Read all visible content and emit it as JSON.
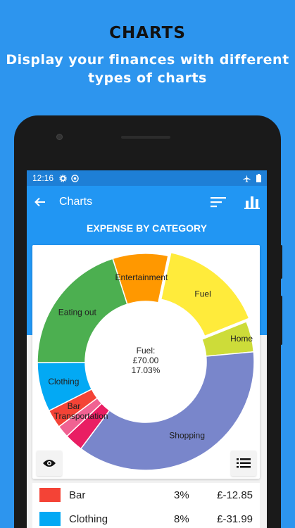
{
  "promo": {
    "title": "CHARTS",
    "subtitle_line1": "Display your finances with different",
    "subtitle_line2": "types of charts"
  },
  "status": {
    "time": "12:16"
  },
  "appbar": {
    "title": "Charts",
    "back_icon": "arrow-left-icon",
    "sort_icon": "sort-icon",
    "chart_type_icon": "bar-chart-icon"
  },
  "section_title": "EXPENSE BY CATEGORY",
  "chart_data": {
    "type": "pie",
    "title": "EXPENSE BY CATEGORY",
    "center": {
      "label": "Fuel:",
      "value": "£70.00",
      "percent": "17.03%"
    },
    "slices": [
      {
        "label": "Entertainment",
        "percent": 9,
        "color": "#FF9800",
        "pulled": false
      },
      {
        "label": "Fuel",
        "percent": 17.03,
        "color": "#FFEB3B",
        "pulled": true
      },
      {
        "label": "Home",
        "percent": 5,
        "color": "#CDDC39",
        "pulled": false
      },
      {
        "label": "Shopping",
        "percent": 40,
        "color": "#7986CB",
        "pulled": false
      },
      {
        "label": "",
        "percent": 3,
        "color": "#E91E63",
        "pulled": false
      },
      {
        "label": "Transportation",
        "percent": 2,
        "color": "#F06292",
        "pulled": false
      },
      {
        "label": "Bar",
        "percent": 3,
        "color": "#F44336",
        "pulled": false
      },
      {
        "label": "Clothing",
        "percent": 8,
        "color": "#03A9F4",
        "pulled": false
      },
      {
        "label": "Eating out",
        "percent": 22,
        "color": "#4CAF50",
        "pulled": false
      }
    ]
  },
  "legend": [
    {
      "name": "Bar",
      "pct": "3%",
      "amount": "£-12.85",
      "color": "#F44336"
    },
    {
      "name": "Clothing",
      "pct": "8%",
      "amount": "£-31.99",
      "color": "#03A9F4"
    }
  ]
}
